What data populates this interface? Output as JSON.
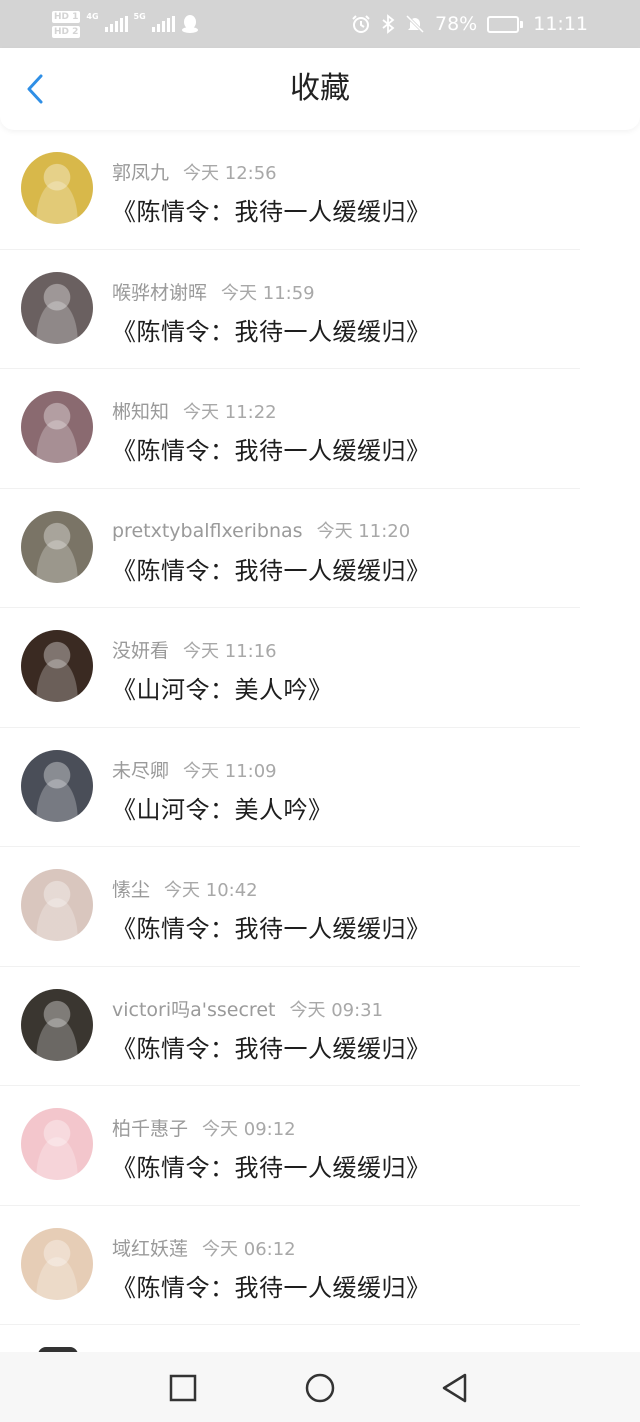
{
  "status_bar": {
    "sim1": "HD 1",
    "sim2": "HD 2",
    "net1": "4G",
    "net2": "5G",
    "battery_text": "78%",
    "battery_level": 0.78,
    "time": "11:11",
    "icons": [
      "alarm-icon",
      "bluetooth-icon",
      "mute-icon",
      "qq-icon"
    ]
  },
  "header": {
    "title": "收藏",
    "back_icon": "chevron-left-icon",
    "accent_color": "#2f8fe6"
  },
  "items": [
    {
      "user": "郭凤九",
      "time": "今天 12:56",
      "content": "《陈情令：我待一人缓缓归》",
      "avatar_color": "#d8b84a"
    },
    {
      "user": "喉骅材谢晖",
      "time": "今天 11:59",
      "content": "《陈情令：我待一人缓缓归》",
      "avatar_color": "#6a6060"
    },
    {
      "user": "郴知知",
      "time": "今天 11:22",
      "content": "《陈情令：我待一人缓缓归》",
      "avatar_color": "#8a6a70"
    },
    {
      "user": "pretxtybalflxeribnas",
      "time": "今天 11:20",
      "content": "《陈情令：我待一人缓缓归》",
      "avatar_color": "#7a7466"
    },
    {
      "user": "没妍看",
      "time": "今天 11:16",
      "content": "《山河令：美人吟》",
      "avatar_color": "#3a2a22"
    },
    {
      "user": "未尽卿",
      "time": "今天 11:09",
      "content": "《山河令：美人吟》",
      "avatar_color": "#4a4e58"
    },
    {
      "user": "愫尘",
      "time": "今天 10:42",
      "content": "《陈情令：我待一人缓缓归》",
      "avatar_color": "#d9c6be"
    },
    {
      "user": "victori吗a'ssecret",
      "time": "今天 09:31",
      "content": "《陈情令：我待一人缓缓归》",
      "avatar_color": "#3a3630"
    },
    {
      "user": "柏千惠子",
      "time": "今天 09:12",
      "content": "《陈情令：我待一人缓缓归》",
      "avatar_color": "#f3c6cc"
    },
    {
      "user": "域红妖莲",
      "time": "今天 06:12",
      "content": "《陈情令：我待一人缓缓归》",
      "avatar_color": "#e6cdb6"
    }
  ],
  "nav_bar": {
    "icons": [
      "recent-apps-icon",
      "home-icon",
      "back-icon"
    ]
  }
}
